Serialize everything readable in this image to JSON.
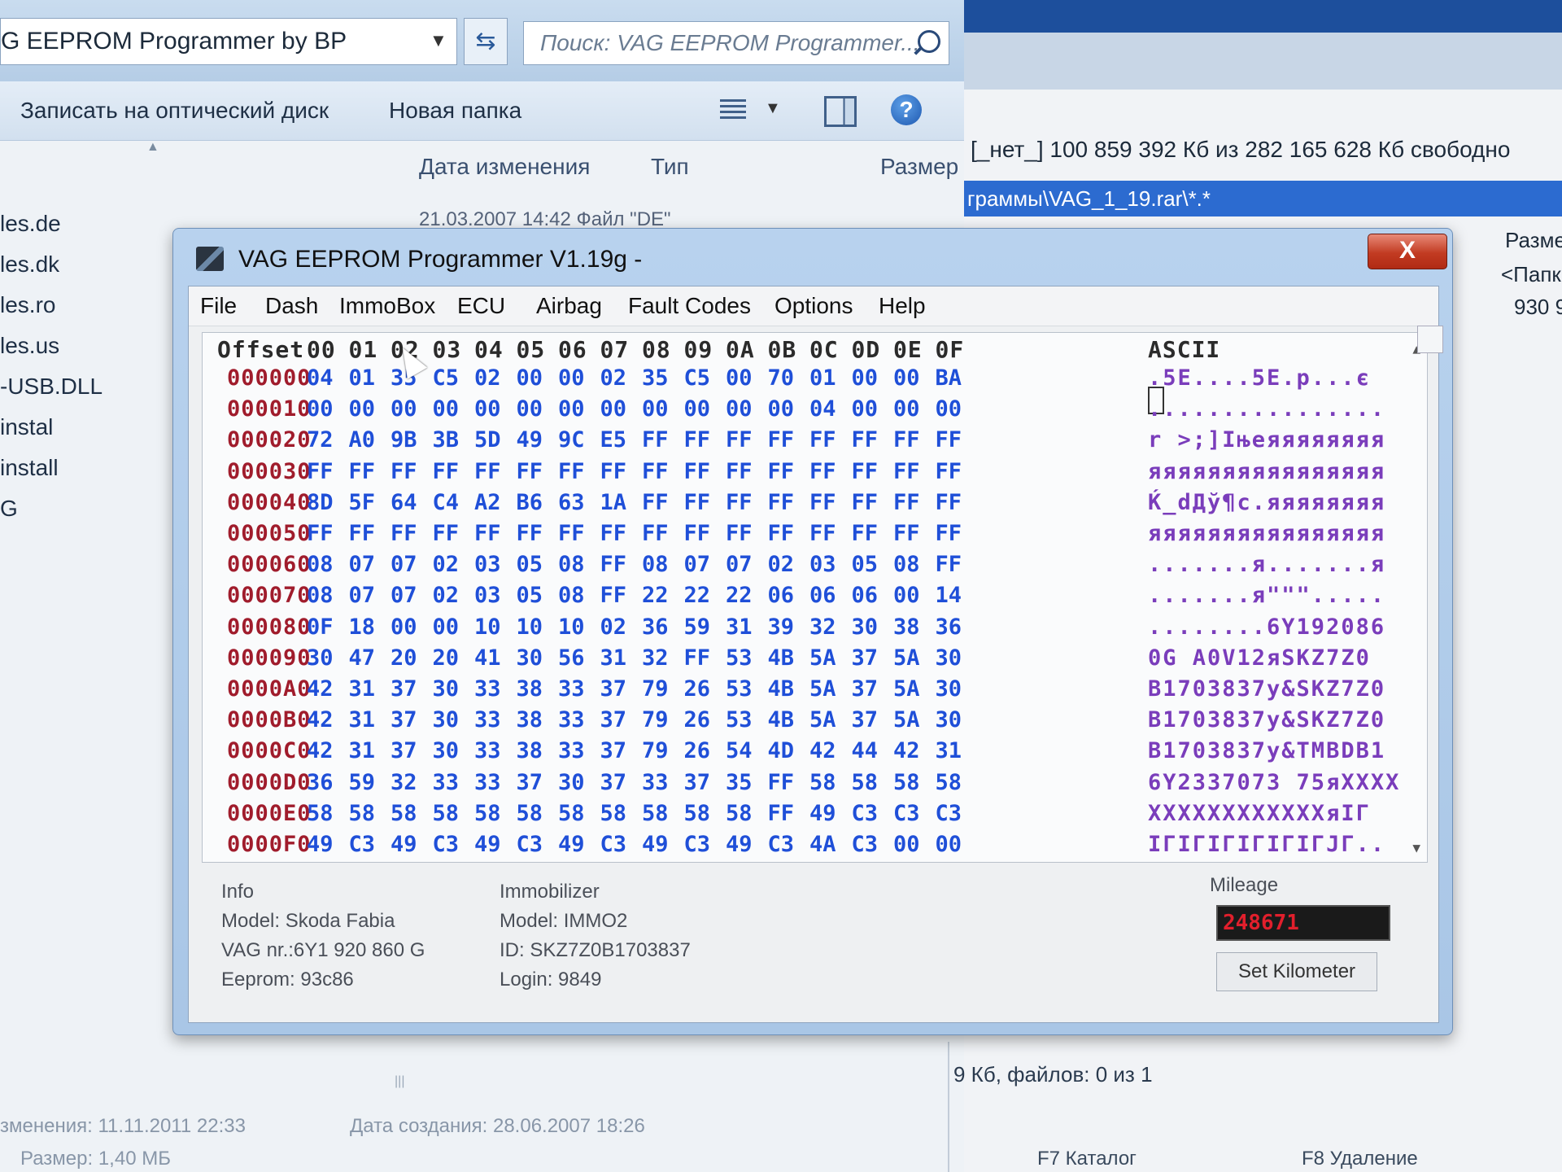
{
  "explorer": {
    "address": "G EEPROM Programmer by BP",
    "search_placeholder": "Поиск: VAG EEPROM Programmer...",
    "toolbar": {
      "burn_label": "Записать на оптический диск",
      "new_folder_label": "Новая папка"
    },
    "columns": {
      "date": "Дата изменения",
      "type": "Тип",
      "size": "Размер"
    },
    "ghost_row": "21.03.2007 14:42        Файл \"DE\"",
    "nav_items": [
      "les.de",
      "les.dk",
      "les.ro",
      "les.us",
      "-USB.DLL",
      "instal",
      "install",
      "G"
    ],
    "status": {
      "modified": "зменения: 11.11.2011 22:33",
      "created": "Дата создания: 28.06.2007 18:26",
      "size": "Размер: 1,40 МБ"
    }
  },
  "commander": {
    "free_space": "[_нет_] 100 859 392 Кб из 282 165 628 Кб свободно",
    "path": "граммы\\VAG_1_19.rar\\*.*",
    "col_size": "Разме",
    "row1": "<Папк",
    "row2": "930 9",
    "files_status": "9 Кб, файлов: 0 из 1",
    "fkeys": [
      "F7 Каталог",
      "F8 Удаление"
    ]
  },
  "vag": {
    "title": "VAG EEPROM Programmer  V1.19g -",
    "close_label": "X",
    "menu": [
      "File",
      "Dash",
      "ImmoBox",
      "ECU",
      "Airbag",
      "Fault Codes",
      "Options",
      "Help"
    ],
    "hex": {
      "header_offset": "Offset",
      "header_cols": [
        "00",
        "01",
        "02",
        "03",
        "04",
        "05",
        "06",
        "07",
        "08",
        "09",
        "0A",
        "0B",
        "0C",
        "0D",
        "0E",
        "0F"
      ],
      "header_ascii": "ASCII",
      "rows": [
        {
          "offset": "000000",
          "bytes": [
            "04",
            "01",
            "35",
            "C5",
            "02",
            "00",
            "00",
            "02",
            "35",
            "C5",
            "00",
            "70",
            "01",
            "00",
            "00",
            "BA"
          ],
          "ascii": " .5E....5E.p...є"
        },
        {
          "offset": "000010",
          "bytes": [
            "00",
            "00",
            "00",
            "00",
            "00",
            "00",
            "00",
            "00",
            "00",
            "00",
            "00",
            "00",
            "04",
            "00",
            "00",
            "00"
          ],
          "ascii": "................"
        },
        {
          "offset": "000020",
          "bytes": [
            "72",
            "A0",
            "9B",
            "3B",
            "5D",
            "49",
            "9C",
            "E5",
            "FF",
            "FF",
            "FF",
            "FF",
            "FF",
            "FF",
            "FF",
            "FF"
          ],
          "ascii": "r >;]Iњеяяяяяяяя"
        },
        {
          "offset": "000030",
          "bytes": [
            "FF",
            "FF",
            "FF",
            "FF",
            "FF",
            "FF",
            "FF",
            "FF",
            "FF",
            "FF",
            "FF",
            "FF",
            "FF",
            "FF",
            "FF",
            "FF"
          ],
          "ascii": "яяяяяяяяяяяяяяяя"
        },
        {
          "offset": "000040",
          "bytes": [
            "8D",
            "5F",
            "64",
            "C4",
            "A2",
            "B6",
            "63",
            "1A",
            "FF",
            "FF",
            "FF",
            "FF",
            "FF",
            "FF",
            "FF",
            "FF"
          ],
          "ascii": "Ќ_dДў¶c.яяяяяяяя"
        },
        {
          "offset": "000050",
          "bytes": [
            "FF",
            "FF",
            "FF",
            "FF",
            "FF",
            "FF",
            "FF",
            "FF",
            "FF",
            "FF",
            "FF",
            "FF",
            "FF",
            "FF",
            "FF",
            "FF"
          ],
          "ascii": "яяяяяяяяяяяяяяяя"
        },
        {
          "offset": "000060",
          "bytes": [
            "08",
            "07",
            "07",
            "02",
            "03",
            "05",
            "08",
            "FF",
            "08",
            "07",
            "07",
            "02",
            "03",
            "05",
            "08",
            "FF"
          ],
          "ascii": ".......я.......я"
        },
        {
          "offset": "000070",
          "bytes": [
            "08",
            "07",
            "07",
            "02",
            "03",
            "05",
            "08",
            "FF",
            "22",
            "22",
            "22",
            "06",
            "06",
            "06",
            "00",
            "14"
          ],
          "ascii": ".......я\"\"\"....."
        },
        {
          "offset": "000080",
          "bytes": [
            "0F",
            "18",
            "00",
            "00",
            "10",
            "10",
            "10",
            "02",
            "36",
            "59",
            "31",
            "39",
            "32",
            "30",
            "38",
            "36"
          ],
          "ascii": "........6Y192086"
        },
        {
          "offset": "000090",
          "bytes": [
            "30",
            "47",
            "20",
            "20",
            "41",
            "30",
            "56",
            "31",
            "32",
            "FF",
            "53",
            "4B",
            "5A",
            "37",
            "5A",
            "30"
          ],
          "ascii": "0G  A0V12яSKZ7Z0"
        },
        {
          "offset": "0000A0",
          "bytes": [
            "42",
            "31",
            "37",
            "30",
            "33",
            "38",
            "33",
            "37",
            "79",
            "26",
            "53",
            "4B",
            "5A",
            "37",
            "5A",
            "30"
          ],
          "ascii": "B1703837y&SKZ7Z0"
        },
        {
          "offset": "0000B0",
          "bytes": [
            "42",
            "31",
            "37",
            "30",
            "33",
            "38",
            "33",
            "37",
            "79",
            "26",
            "53",
            "4B",
            "5A",
            "37",
            "5A",
            "30"
          ],
          "ascii": "B1703837y&SKZ7Z0"
        },
        {
          "offset": "0000C0",
          "bytes": [
            "42",
            "31",
            "37",
            "30",
            "33",
            "38",
            "33",
            "37",
            "79",
            "26",
            "54",
            "4D",
            "42",
            "44",
            "42",
            "31"
          ],
          "ascii": "B1703837y&TMBDB1"
        },
        {
          "offset": "0000D0",
          "bytes": [
            "36",
            "59",
            "32",
            "33",
            "33",
            "37",
            "30",
            "37",
            "33",
            "37",
            "35",
            "FF",
            "58",
            "58",
            "58",
            "58"
          ],
          "ascii": "6Y2337073 75яXXXX"
        },
        {
          "offset": "0000E0",
          "bytes": [
            "58",
            "58",
            "58",
            "58",
            "58",
            "58",
            "58",
            "58",
            "58",
            "58",
            "58",
            "FF",
            "49",
            "C3",
            "C3",
            "C3"
          ],
          "ascii": "XXXXXXXXXXXXяIГ"
        },
        {
          "offset": "0000F0",
          "bytes": [
            "49",
            "C3",
            "49",
            "C3",
            "49",
            "C3",
            "49",
            "C3",
            "49",
            "C3",
            "49",
            "C3",
            "4A",
            "C3",
            "00",
            "00"
          ],
          "ascii": "IГIГIГIГIГIГJГ.."
        }
      ]
    },
    "info": {
      "heading": "Info",
      "model": "Model:   Skoda Fabia",
      "vag_nr": "VAG nr.:6Y1 920 860 G",
      "eeprom": "Eeprom: 93c86"
    },
    "immobilizer": {
      "heading": "Immobilizer",
      "model": "Model:   IMMO2",
      "id": "ID: SKZ7Z0B1703837",
      "login": "Login: 9849"
    },
    "mileage": {
      "label": "Mileage",
      "value": "248671",
      "button_label": "Set Kilometer"
    }
  }
}
